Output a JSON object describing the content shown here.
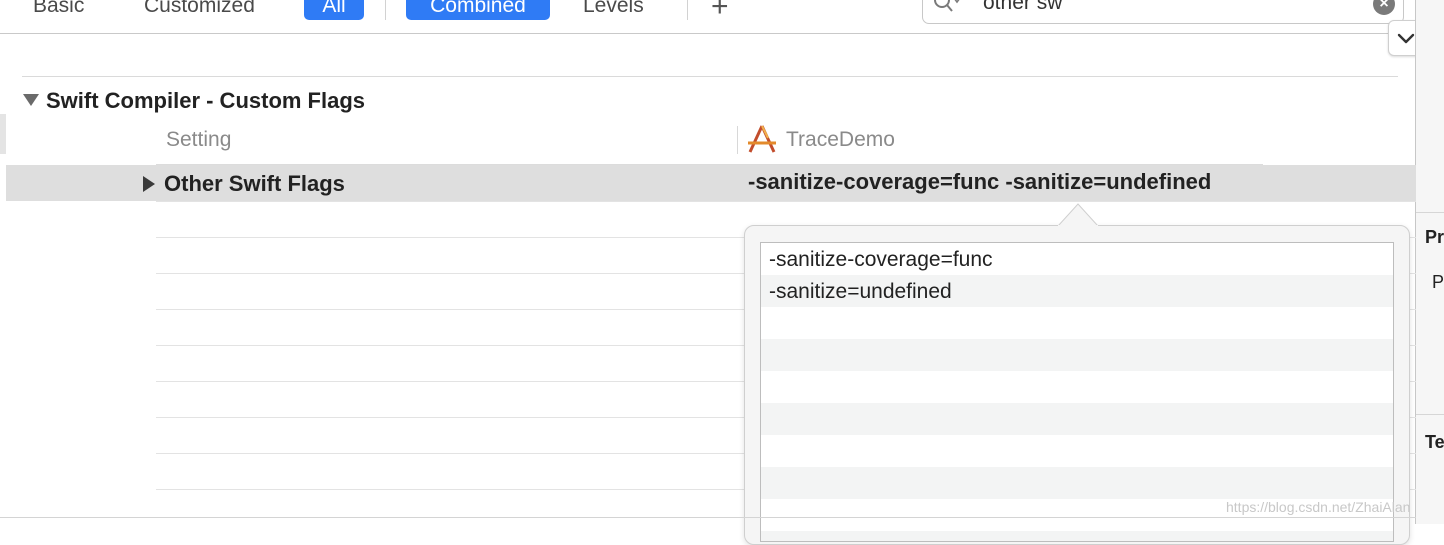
{
  "toolbar": {
    "basic_label": "Basic",
    "customized_label": "Customized",
    "all_label": "All",
    "combined_label": "Combined",
    "levels_label": "Levels",
    "add_label": "+",
    "search_value": "other sw",
    "clear_label": "×"
  },
  "section": {
    "title": "Swift Compiler - Custom Flags",
    "column_setting": "Setting",
    "column_target": "TraceDemo"
  },
  "row": {
    "name": "Other Swift Flags",
    "value": "-sanitize-coverage=func -sanitize=undefined"
  },
  "popover": {
    "items": [
      "-sanitize-coverage=func",
      "-sanitize=undefined"
    ]
  },
  "inspector": {
    "heading1": "Pr",
    "text1": "P",
    "heading2": "Te"
  },
  "watermark": "https://blog.csdn.net/ZhaiAlan",
  "colors": {
    "accent": "#2f7bf5",
    "selected_row": "#dedede",
    "stripe": "#f3f4f4"
  }
}
